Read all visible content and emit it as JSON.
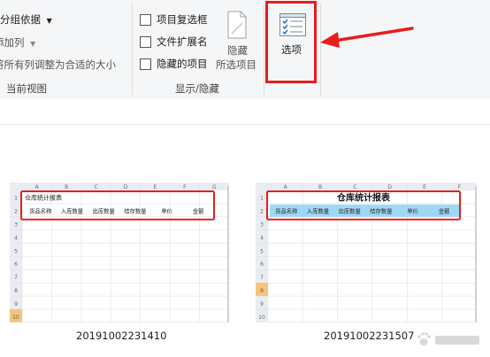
{
  "ribbon": {
    "groups": {
      "current_view": {
        "group_by": "分组依据",
        "add_column": "添加列",
        "size_all_columns": "将所有列调整为合适的大小",
        "label": "当前视图"
      },
      "show_hide": {
        "item_checkboxes": "项目复选框",
        "file_extensions": "文件扩展名",
        "hidden_items": "隐藏的项目",
        "hide_selected_line1": "隐藏",
        "hide_selected_line2": "所选项目",
        "label": "显示/隐藏"
      },
      "options": {
        "label": "选项"
      }
    }
  },
  "files": [
    {
      "name": "20191002231410",
      "sheet": {
        "title": "仓库统计报表",
        "headers": [
          "货品名称",
          "入库数量",
          "出库数量",
          "结存数量",
          "单价",
          "金额"
        ],
        "columns": [
          "A",
          "B",
          "C",
          "D",
          "E",
          "F",
          "G"
        ],
        "rows": [
          "1",
          "2",
          "3",
          "4",
          "5",
          "6",
          "7",
          "8",
          "9",
          "10"
        ]
      }
    },
    {
      "name": "20191002231507",
      "sheet": {
        "title": "仓库统计报表",
        "headers": [
          "货品名称",
          "入库数量",
          "出库数量",
          "结存数量",
          "单价",
          "金额"
        ],
        "columns": [
          "A",
          "B",
          "C",
          "D",
          "E",
          "F"
        ],
        "rows": [
          "1",
          "2",
          "3",
          "4",
          "5",
          "6",
          "7",
          "8",
          "9",
          "10"
        ]
      }
    }
  ],
  "colors": {
    "highlight": "#e81d1d",
    "header_fill": "#9fd8f5",
    "selected_row": "#f7c27a"
  }
}
